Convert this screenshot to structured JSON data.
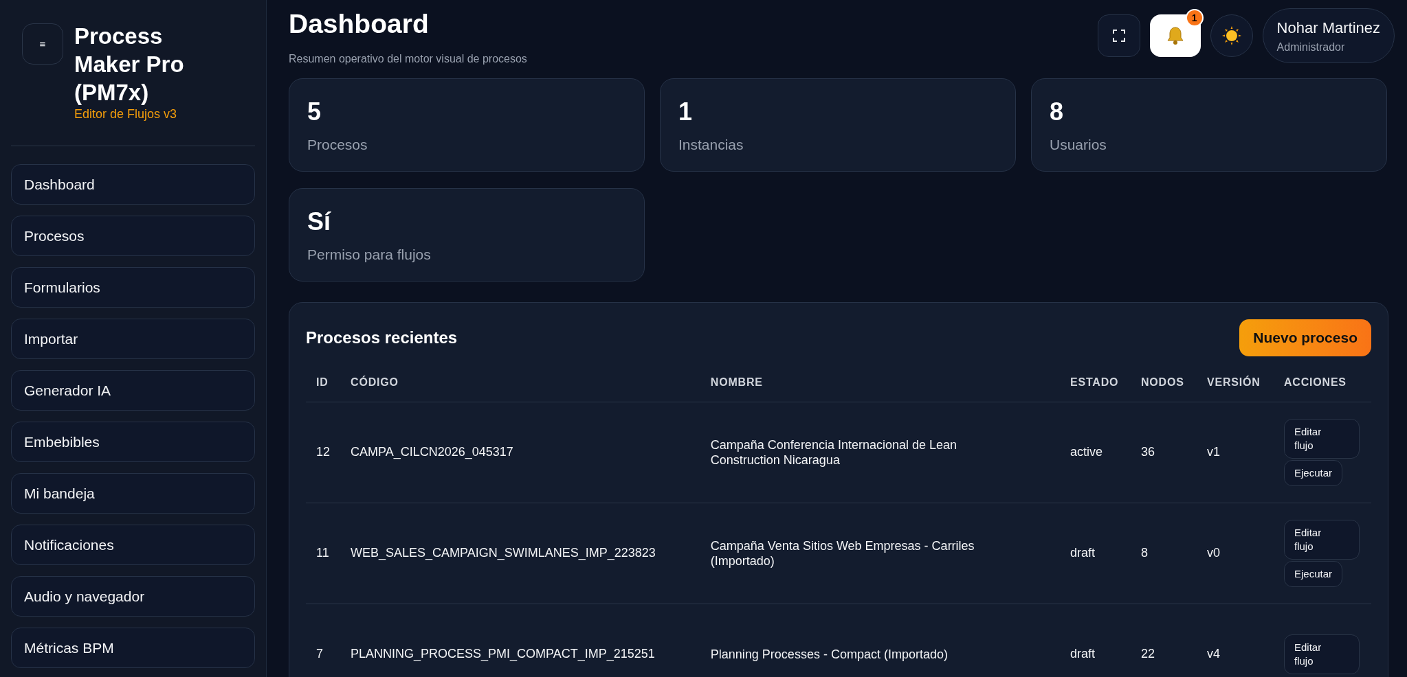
{
  "sidebar": {
    "menu_icon": "≡",
    "title": "Process Maker Pro (PM7x)",
    "subtitle": "Editor de Flujos v3",
    "items": [
      {
        "label": "Dashboard"
      },
      {
        "label": "Procesos"
      },
      {
        "label": "Formularios"
      },
      {
        "label": "Importar"
      },
      {
        "label": "Generador IA"
      },
      {
        "label": "Embebibles"
      },
      {
        "label": "Mi bandeja"
      },
      {
        "label": "Notificaciones"
      },
      {
        "label": "Audio y navegador"
      },
      {
        "label": "Métricas BPM"
      }
    ]
  },
  "header": {
    "title": "Dashboard",
    "subtitle": "Resumen operativo del motor visual de procesos",
    "notification_count": "1",
    "user": {
      "name": "Nohar Martinez",
      "role": "Administrador"
    }
  },
  "stats": [
    {
      "value": "5",
      "label": "Procesos"
    },
    {
      "value": "1",
      "label": "Instancias"
    },
    {
      "value": "8",
      "label": "Usuarios"
    },
    {
      "value": "Sí",
      "label": "Permiso para flujos"
    }
  ],
  "recent": {
    "title": "Procesos recientes",
    "new_button": "Nuevo proceso",
    "columns": [
      "ID",
      "CÓDIGO",
      "NOMBRE",
      "ESTADO",
      "NODOS",
      "VERSIÓN",
      "ACCIONES"
    ],
    "rows": [
      {
        "id": "12",
        "code": "CAMPA_CILCN2026_045317",
        "name": "Campaña Conferencia Internacional de Lean Construction Nicaragua",
        "status": "active",
        "nodes": "36",
        "version": "v1",
        "actions": [
          "Editar flujo",
          "Ejecutar"
        ]
      },
      {
        "id": "11",
        "code": "WEB_SALES_CAMPAIGN_SWIMLANES_IMP_223823",
        "name": "Campaña Venta Sitios Web Empresas - Carriles (Importado)",
        "status": "draft",
        "nodes": "8",
        "version": "v0",
        "actions": [
          "Editar flujo",
          "Ejecutar"
        ]
      },
      {
        "id": "7",
        "code": "PLANNING_PROCESS_PMI_COMPACT_IMP_215251",
        "name": "Planning Processes - Compact (Importado)",
        "status": "draft",
        "nodes": "22",
        "version": "v4",
        "actions": [
          "Editar flujo"
        ]
      }
    ]
  }
}
